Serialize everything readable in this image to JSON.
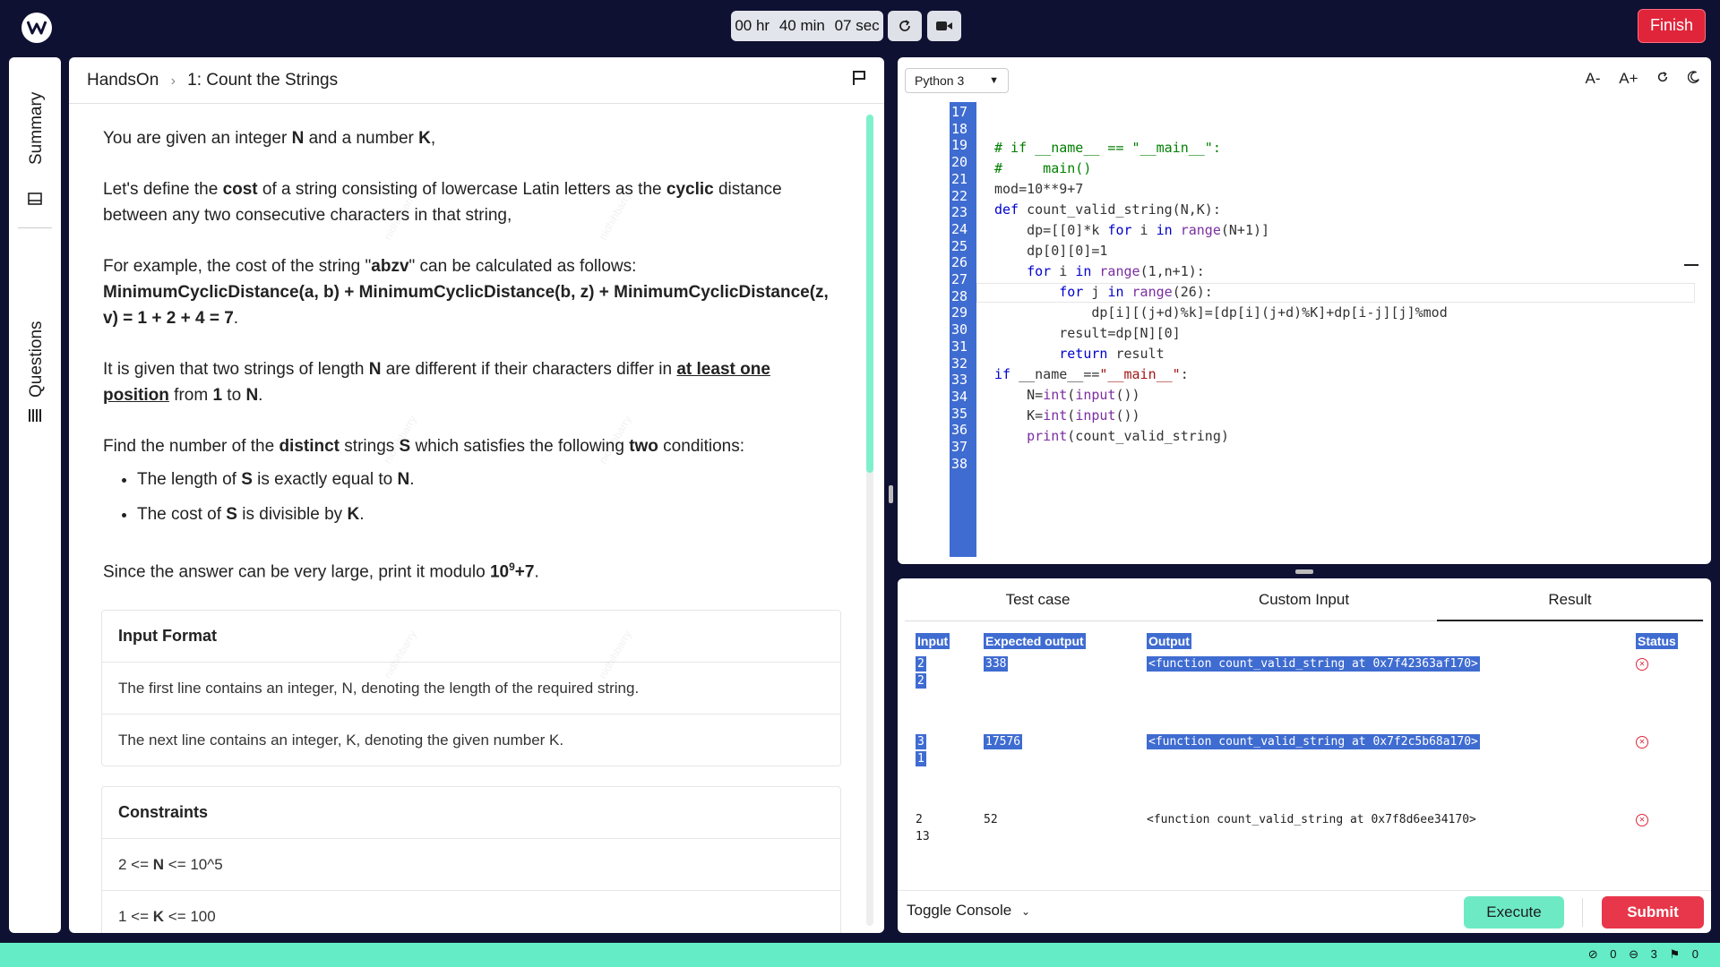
{
  "header": {
    "timer": {
      "hours": "00 hr",
      "minutes": "40 min",
      "seconds": "07 sec"
    },
    "finish_label": "Finish"
  },
  "rail": {
    "summary_label": "Summary",
    "questions_label": "Questions"
  },
  "problem": {
    "breadcrumb_root": "HandsOn",
    "breadcrumb_title": "1: Count the Strings",
    "p1": [
      "You are given an integer ",
      "N",
      " and a number ",
      "K",
      ","
    ],
    "p2": [
      "Let's define the ",
      "cost",
      " of a string consisting of lowercase Latin letters as the ",
      "cyclic",
      " distance between any two consecutive characters in that string,"
    ],
    "p3": [
      "For example, the cost of the string \"",
      "abzv",
      "\" can be calculated as follows:",
      "MinimumCyclicDistance(a, b) + MinimumCyclicDistance(b, z) + MinimumCyclicDistance(z, v) = 1 + 2 + 4 = 7",
      "."
    ],
    "p4": [
      "It is given that two strings of length ",
      "N",
      " are different if their characters differ in ",
      "at least one position",
      " from ",
      "1",
      " to ",
      "N",
      "."
    ],
    "p5": [
      "Find the number of the ",
      "distinct",
      " strings ",
      "S",
      " which satisfies the following ",
      "two",
      " conditions:"
    ],
    "li1": [
      "The length of ",
      "S",
      " is exactly equal to ",
      "N",
      "."
    ],
    "li2": [
      "The cost of ",
      "S",
      " is divisible by ",
      "K",
      "."
    ],
    "p6": [
      "Since the answer can be very large, print it modulo ",
      "10",
      "9",
      "+7",
      "."
    ],
    "input_format": {
      "title": "Input Format",
      "rows": [
        "The first line contains an integer, N, denoting the length of the required string.",
        "The next line contains an integer, K, denoting the given number K."
      ]
    },
    "constraints": {
      "title": "Constraints",
      "rows": [
        [
          "2 <= ",
          "N",
          " <= 10^5"
        ],
        [
          "1 <= ",
          "K",
          " <= 100"
        ]
      ]
    },
    "watermark": "nidhihbarry"
  },
  "editor": {
    "language": "Python 3",
    "tools": [
      "A-",
      "A+"
    ],
    "line_numbers": [
      "17",
      "18",
      "19",
      "20",
      "21",
      "22",
      "23",
      "24",
      "25",
      "26",
      "27",
      "28",
      "29",
      "30",
      "31",
      "32",
      "33",
      "34",
      "35",
      "36",
      "37",
      "38"
    ]
  },
  "console": {
    "tabs": [
      "Test case",
      "Custom Input",
      "Result"
    ],
    "active_tab": "Result",
    "columns": [
      "Input",
      "Expected output",
      "Output",
      "Status"
    ],
    "rows": [
      {
        "input": [
          "2",
          "2"
        ],
        "expected": "338",
        "output": "<function count_valid_string at 0x7f42363af170>",
        "status": "fail"
      },
      {
        "input": [
          "3",
          "1"
        ],
        "expected": "17576",
        "output": "<function count_valid_string at 0x7f2c5b68a170>",
        "status": "fail"
      },
      {
        "input": [
          "2",
          "13"
        ],
        "expected": "52",
        "output": "<function count_valid_string at 0x7f8d6ee34170>",
        "status": "fail"
      }
    ],
    "toggle_label": "Toggle Console",
    "execute_label": "Execute",
    "submit_label": "Submit"
  },
  "statusbar": {
    "ok_count": "0",
    "fail_count": "3",
    "flag_count": "0"
  },
  "colors": {
    "navy": "#0f1133",
    "accent_green": "#63ecc5",
    "danger": "#e0253b",
    "gutter": "#3f6cd1"
  }
}
